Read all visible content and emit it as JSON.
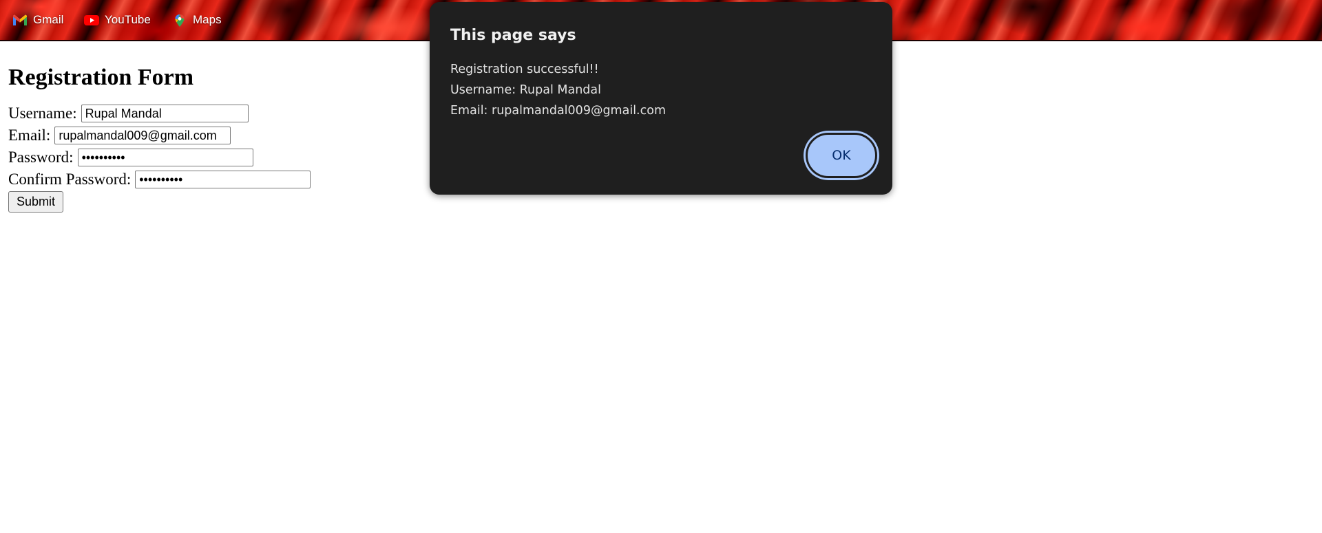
{
  "bookmarks": [
    {
      "label": "Gmail",
      "icon": "gmail-icon"
    },
    {
      "label": "YouTube",
      "icon": "youtube-icon"
    },
    {
      "label": "Maps",
      "icon": "maps-icon"
    }
  ],
  "form": {
    "heading": "Registration Form",
    "username_label": "Username:",
    "username_value": "Rupal Mandal",
    "email_label": "Email:",
    "email_value": "rupalmandal009@gmail.com",
    "password_label": "Password:",
    "password_value": "••••••••••",
    "confirm_label": "Confirm Password:",
    "confirm_value": "••••••••••",
    "submit_label": "Submit"
  },
  "dialog": {
    "title": "This page says",
    "lines": [
      "Registration successful!!",
      "Username: Rupal Mandal",
      "Email: rupalmandal009@gmail.com"
    ],
    "ok_label": "OK"
  },
  "colors": {
    "dialog_bg": "#1f1f1f",
    "ok_button": "#a8c7fa",
    "ok_text": "#062e6f",
    "bar_accent": "#c41408"
  }
}
